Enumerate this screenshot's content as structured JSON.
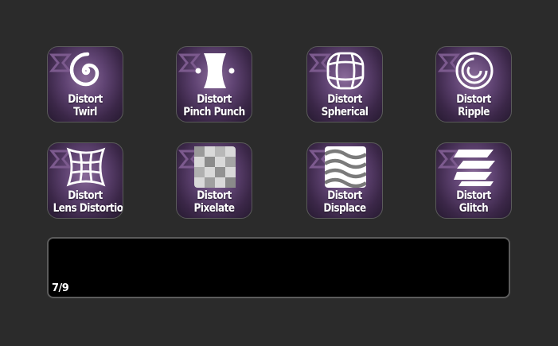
{
  "keys": [
    {
      "line1": "Distort",
      "line2": "Twirl",
      "icon": "twirl-icon"
    },
    {
      "line1": "Distort",
      "line2": "Pinch Punch",
      "icon": "pinch-punch-icon"
    },
    {
      "line1": "Distort",
      "line2": "Spherical",
      "icon": "spherical-icon"
    },
    {
      "line1": "Distort",
      "line2": "Ripple",
      "icon": "ripple-icon"
    },
    {
      "line1": "Distort",
      "line2": "Lens Distortion",
      "icon": "lens-distortion-icon"
    },
    {
      "line1": "Distort",
      "line2": "Pixelate",
      "icon": "pixelate-icon"
    },
    {
      "line1": "Distort",
      "line2": "Displace",
      "icon": "displace-icon"
    },
    {
      "line1": "Distort",
      "line2": "Glitch",
      "icon": "glitch-icon"
    }
  ],
  "page_indicator": "7/9",
  "colors": {
    "background": "#2b2b2b",
    "key_accent": "#5f4372",
    "strip": "#000000",
    "text": "#ffffff"
  }
}
